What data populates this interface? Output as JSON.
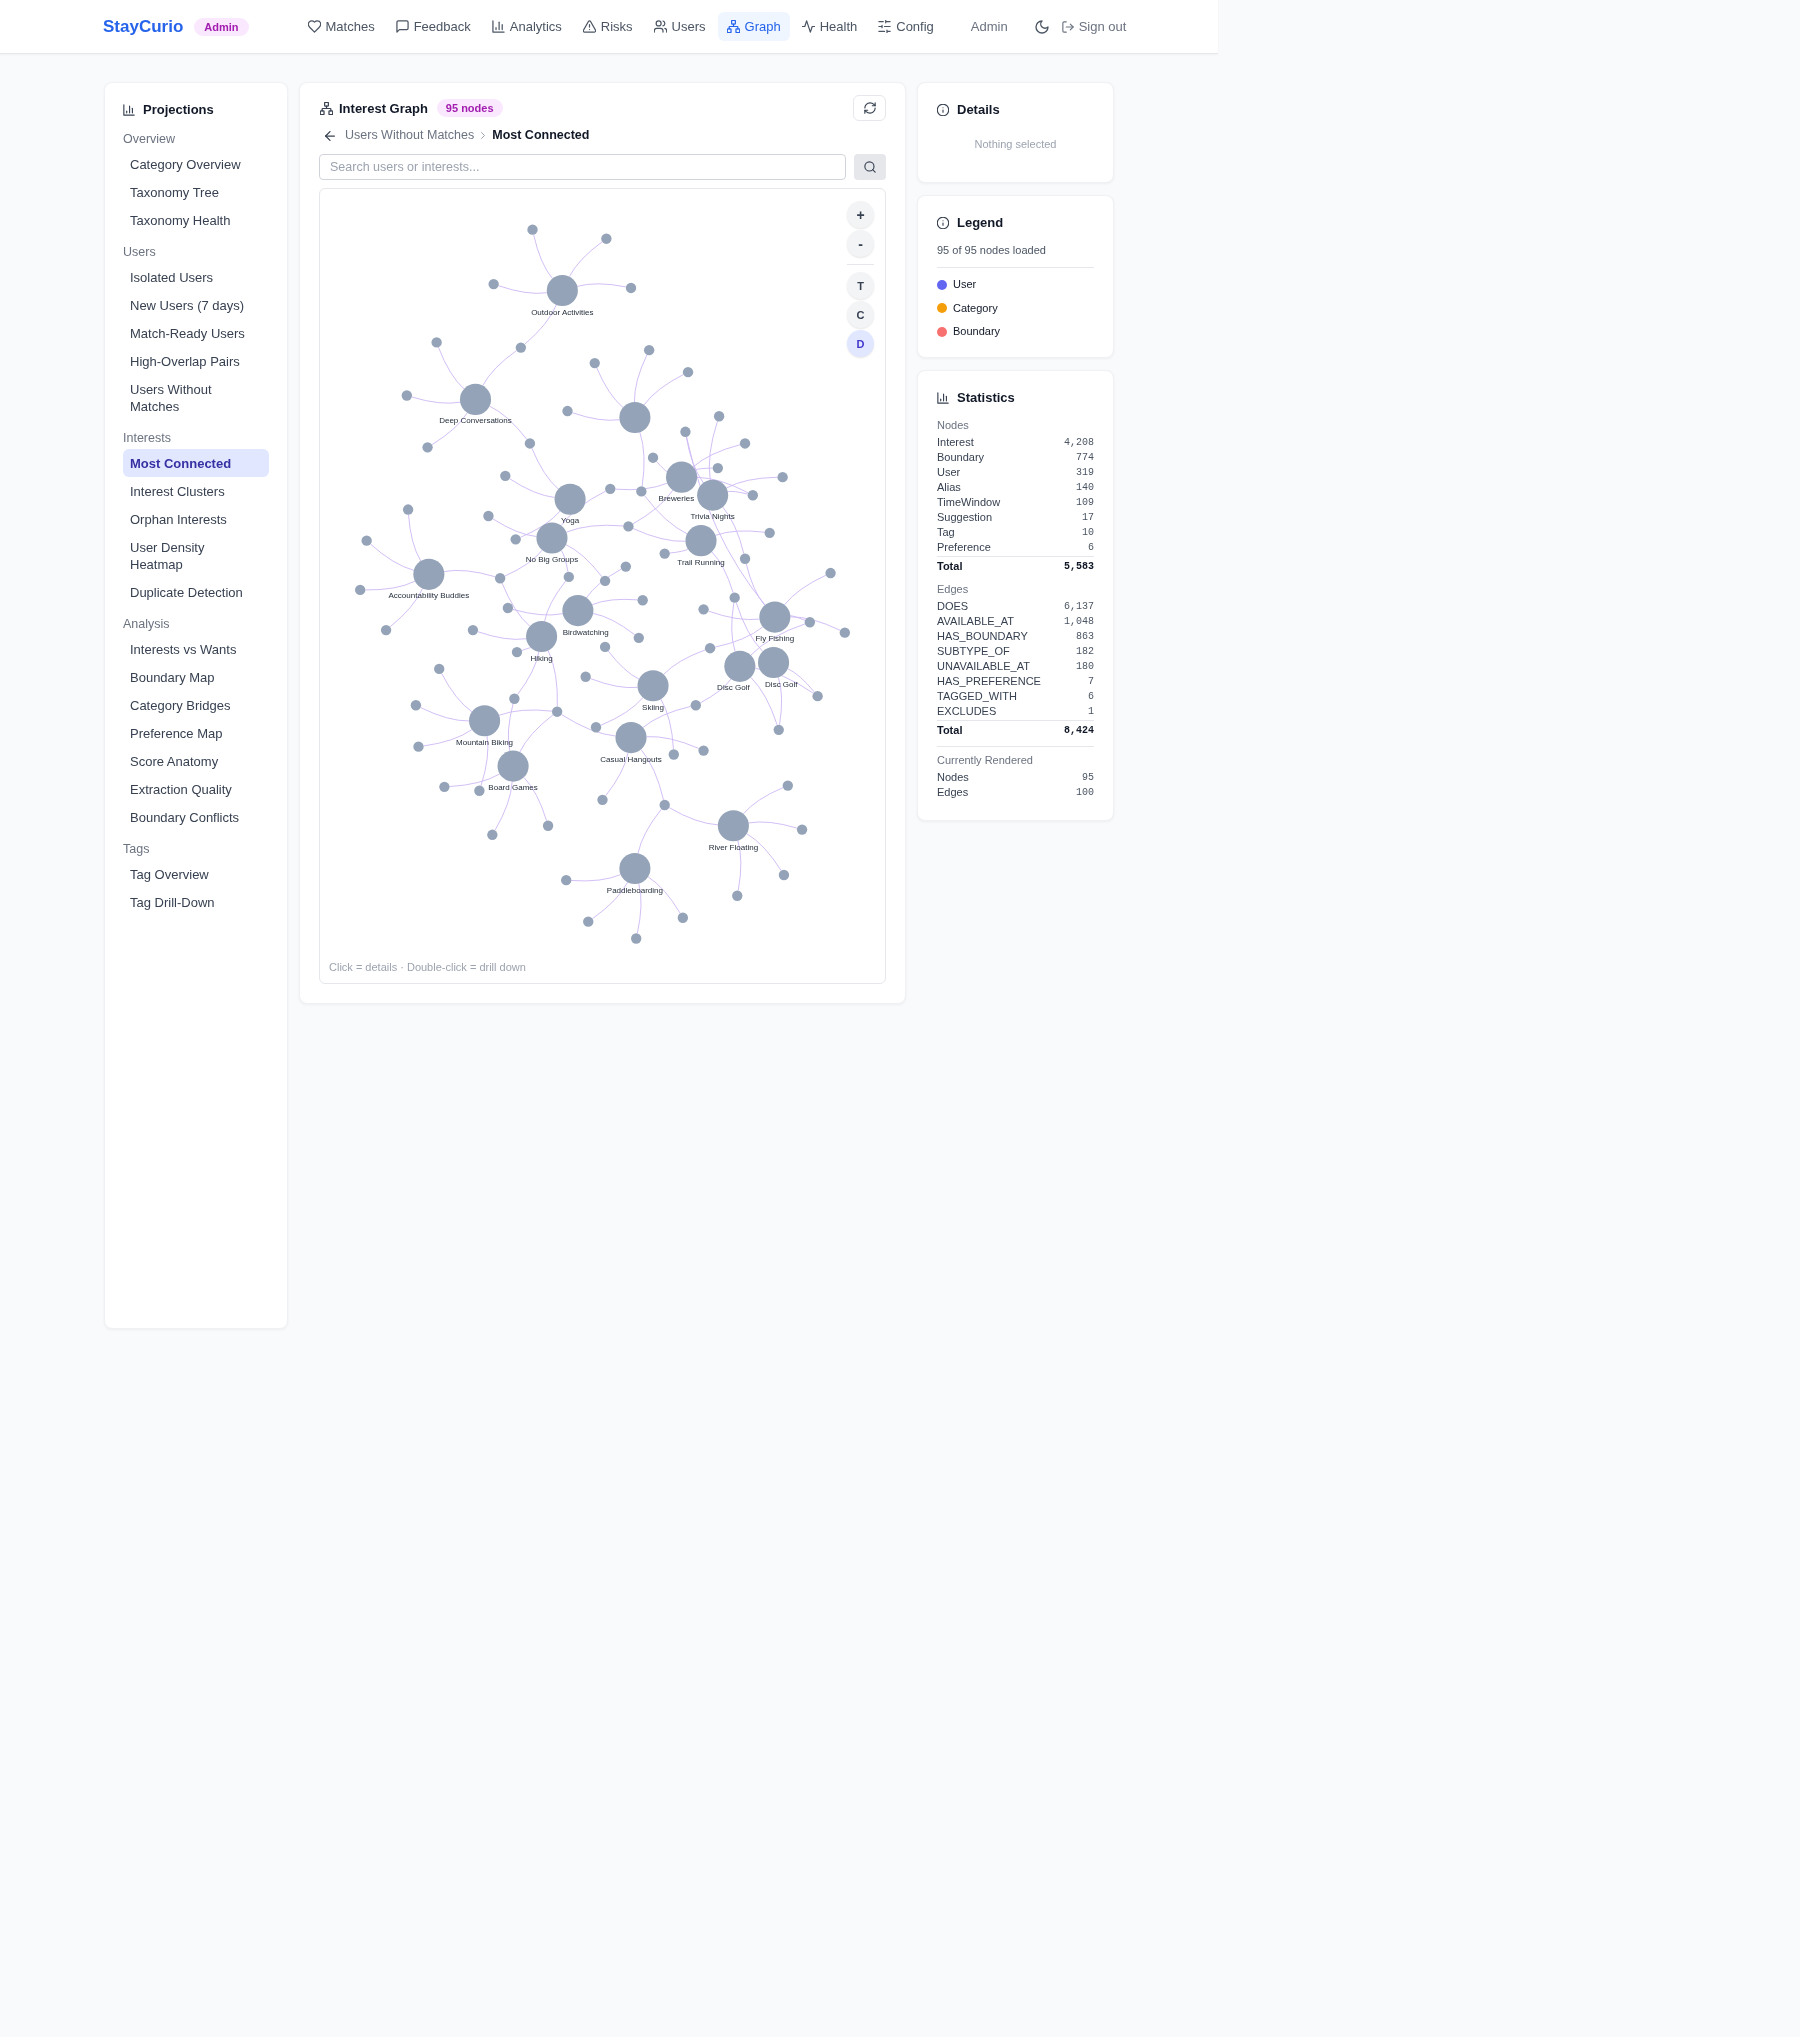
{
  "header": {
    "logo": "StayCurio",
    "badge": "Admin",
    "nav": [
      {
        "label": "Matches",
        "selected": false
      },
      {
        "label": "Feedback",
        "selected": false
      },
      {
        "label": "Analytics",
        "selected": false
      },
      {
        "label": "Risks",
        "selected": false
      },
      {
        "label": "Users",
        "selected": false
      },
      {
        "label": "Graph",
        "selected": true
      },
      {
        "label": "Health",
        "selected": false
      },
      {
        "label": "Config",
        "selected": false
      }
    ],
    "user": "Admin",
    "sign_out": "Sign out"
  },
  "sidebar": {
    "title": "Projections",
    "groups": [
      {
        "label": "Overview",
        "items": [
          {
            "label": "Category Overview",
            "selected": false
          },
          {
            "label": "Taxonomy Tree",
            "selected": false
          },
          {
            "label": "Taxonomy Health",
            "selected": false
          }
        ]
      },
      {
        "label": "Users",
        "items": [
          {
            "label": "Isolated Users",
            "selected": false
          },
          {
            "label": "New Users (7 days)",
            "selected": false
          },
          {
            "label": "Match-Ready Users",
            "selected": false
          },
          {
            "label": "High-Overlap Pairs",
            "selected": false
          },
          {
            "label": "Users Without Matches",
            "selected": false
          }
        ]
      },
      {
        "label": "Interests",
        "items": [
          {
            "label": "Most Connected",
            "selected": true
          },
          {
            "label": "Interest Clusters",
            "selected": false
          },
          {
            "label": "Orphan Interests",
            "selected": false
          },
          {
            "label": "User Density Heatmap",
            "selected": false
          },
          {
            "label": "Duplicate Detection",
            "selected": false
          }
        ]
      },
      {
        "label": "Analysis",
        "items": [
          {
            "label": "Interests vs Wants",
            "selected": false
          },
          {
            "label": "Boundary Map",
            "selected": false
          },
          {
            "label": "Category Bridges",
            "selected": false
          },
          {
            "label": "Preference Map",
            "selected": false
          },
          {
            "label": "Score Anatomy",
            "selected": false
          },
          {
            "label": "Extraction Quality",
            "selected": false
          },
          {
            "label": "Boundary Conflicts",
            "selected": false
          }
        ]
      },
      {
        "label": "Tags",
        "items": [
          {
            "label": "Tag Overview",
            "selected": false
          },
          {
            "label": "Tag Drill-Down",
            "selected": false
          }
        ]
      }
    ]
  },
  "graph_panel": {
    "title": "Interest Graph",
    "badge": "95 nodes",
    "breadcrumb": [
      {
        "label": "Users Without Matches",
        "current": false
      },
      {
        "label": "Most Connected",
        "current": true
      }
    ],
    "search": {
      "placeholder": "Search users or interests..."
    },
    "zoom_controls": [
      {
        "label": "+"
      },
      {
        "label": "-"
      }
    ],
    "view_modes": [
      {
        "label": "T",
        "selected": false
      },
      {
        "label": "C",
        "selected": false
      },
      {
        "label": "D",
        "selected": true
      }
    ],
    "nodes": [
      {
        "kind": "hub",
        "label": "Outdoor Activities"
      },
      {
        "kind": "hub",
        "label": "Deep Conversations"
      },
      {
        "kind": "hub"
      },
      {
        "kind": "hub",
        "label": "Yoga"
      },
      {
        "kind": "hub",
        "label": "No Big Groups"
      },
      {
        "kind": "hub",
        "label": "Breweries"
      },
      {
        "kind": "hub",
        "label": "Trivia Nights"
      },
      {
        "kind": "hub",
        "label": "Trail Running"
      },
      {
        "kind": "hub",
        "label": "Accountability Buddies"
      },
      {
        "kind": "hub",
        "label": "Birdwatching"
      },
      {
        "kind": "hub",
        "label": "Hiking"
      },
      {
        "kind": "hub",
        "label": "Fly Fishing"
      },
      {
        "kind": "hub",
        "label": "Disc Golf"
      },
      {
        "kind": "hub",
        "label": "Disc Golf"
      },
      {
        "kind": "hub",
        "label": "Skiing"
      },
      {
        "kind": "hub",
        "label": "Mountain Biking"
      },
      {
        "kind": "hub",
        "label": "Board Games"
      },
      {
        "kind": "hub",
        "label": "Casual Hangouts"
      },
      {
        "kind": "hub",
        "label": "River Floating"
      },
      {
        "kind": "hub",
        "label": "Paddleboarding"
      },
      {
        "kind": "leaf"
      },
      {
        "kind": "leaf"
      },
      {
        "kind": "leaf"
      },
      {
        "kind": "leaf"
      },
      {
        "kind": "leaf"
      },
      {
        "kind": "leaf"
      },
      {
        "kind": "leaf"
      },
      {
        "kind": "leaf"
      },
      {
        "kind": "leaf"
      },
      {
        "kind": "leaf"
      },
      {
        "kind": "leaf"
      },
      {
        "kind": "leaf"
      },
      {
        "kind": "leaf"
      },
      {
        "kind": "leaf"
      },
      {
        "kind": "leaf"
      },
      {
        "kind": "leaf"
      },
      {
        "kind": "leaf"
      },
      {
        "kind": "leaf"
      },
      {
        "kind": "leaf"
      },
      {
        "kind": "leaf"
      },
      {
        "kind": "leaf"
      },
      {
        "kind": "leaf"
      },
      {
        "kind": "leaf"
      },
      {
        "kind": "leaf"
      },
      {
        "kind": "leaf"
      },
      {
        "kind": "leaf"
      },
      {
        "kind": "leaf"
      },
      {
        "kind": "leaf"
      },
      {
        "kind": "leaf"
      },
      {
        "kind": "leaf"
      },
      {
        "kind": "leaf"
      },
      {
        "kind": "leaf"
      },
      {
        "kind": "leaf"
      },
      {
        "kind": "leaf"
      },
      {
        "kind": "leaf"
      },
      {
        "kind": "leaf"
      },
      {
        "kind": "leaf"
      },
      {
        "kind": "leaf"
      },
      {
        "kind": "leaf"
      },
      {
        "kind": "leaf"
      },
      {
        "kind": "leaf"
      },
      {
        "kind": "leaf"
      },
      {
        "kind": "leaf"
      },
      {
        "kind": "leaf"
      },
      {
        "kind": "leaf"
      },
      {
        "kind": "leaf"
      },
      {
        "kind": "leaf"
      },
      {
        "kind": "leaf"
      },
      {
        "kind": "leaf"
      },
      {
        "kind": "leaf"
      },
      {
        "kind": "leaf"
      },
      {
        "kind": "leaf"
      },
      {
        "kind": "leaf"
      },
      {
        "kind": "leaf"
      },
      {
        "kind": "leaf"
      },
      {
        "kind": "leaf"
      },
      {
        "kind": "leaf"
      },
      {
        "kind": "leaf"
      },
      {
        "kind": "leaf"
      },
      {
        "kind": "leaf"
      },
      {
        "kind": "leaf"
      },
      {
        "kind": "leaf"
      },
      {
        "kind": "leaf"
      },
      {
        "kind": "leaf"
      },
      {
        "kind": "leaf"
      },
      {
        "kind": "leaf"
      },
      {
        "kind": "leaf"
      },
      {
        "kind": "leaf"
      },
      {
        "kind": "leaf"
      },
      {
        "kind": "leaf"
      },
      {
        "kind": "leaf"
      },
      {
        "kind": "leaf"
      },
      {
        "kind": "leaf"
      },
      {
        "kind": "leaf"
      },
      {
        "kind": "leaf"
      }
    ],
    "hint": "Click = details · Double-click = drill down"
  },
  "details": {
    "title": "Details",
    "empty_text": "Nothing selected"
  },
  "legend": {
    "title": "Legend",
    "summary": "95 of 95 nodes loaded",
    "items": [
      {
        "label": "User",
        "color": "#6366f1"
      },
      {
        "label": "Category",
        "color": "#f59e0b"
      },
      {
        "label": "Boundary",
        "color": "#f87171"
      }
    ]
  },
  "statistics": {
    "title": "Statistics",
    "sections": [
      {
        "kind": "breakdown",
        "label": "Nodes",
        "rows": [
          {
            "name": "Interest",
            "value": "4,208"
          },
          {
            "name": "Boundary",
            "value": "774"
          },
          {
            "name": "User",
            "value": "319"
          },
          {
            "name": "Alias",
            "value": "140"
          },
          {
            "name": "TimeWindow",
            "value": "109"
          },
          {
            "name": "Suggestion",
            "value": "17"
          },
          {
            "name": "Tag",
            "value": "10"
          },
          {
            "name": "Preference",
            "value": "6"
          }
        ],
        "total": {
          "name": "Total",
          "value": "5,583"
        }
      },
      {
        "kind": "breakdown",
        "label": "Edges",
        "rows": [
          {
            "name": "DOES",
            "value": "6,137"
          },
          {
            "name": "AVAILABLE_AT",
            "value": "1,048"
          },
          {
            "name": "HAS_BOUNDARY",
            "value": "863"
          },
          {
            "name": "SUBTYPE_OF",
            "value": "182"
          },
          {
            "name": "UNAVAILABLE_AT",
            "value": "180"
          },
          {
            "name": "HAS_PREFERENCE",
            "value": "7"
          },
          {
            "name": "TAGGED_WITH",
            "value": "6"
          },
          {
            "name": "EXCLUDES",
            "value": "1"
          }
        ],
        "total": {
          "name": "Total",
          "value": "8,424"
        }
      },
      {
        "kind": "summary",
        "label": "Currently Rendered",
        "rows": [
          {
            "name": "Nodes",
            "value": "95"
          },
          {
            "name": "Edges",
            "value": "100"
          }
        ]
      }
    ]
  }
}
